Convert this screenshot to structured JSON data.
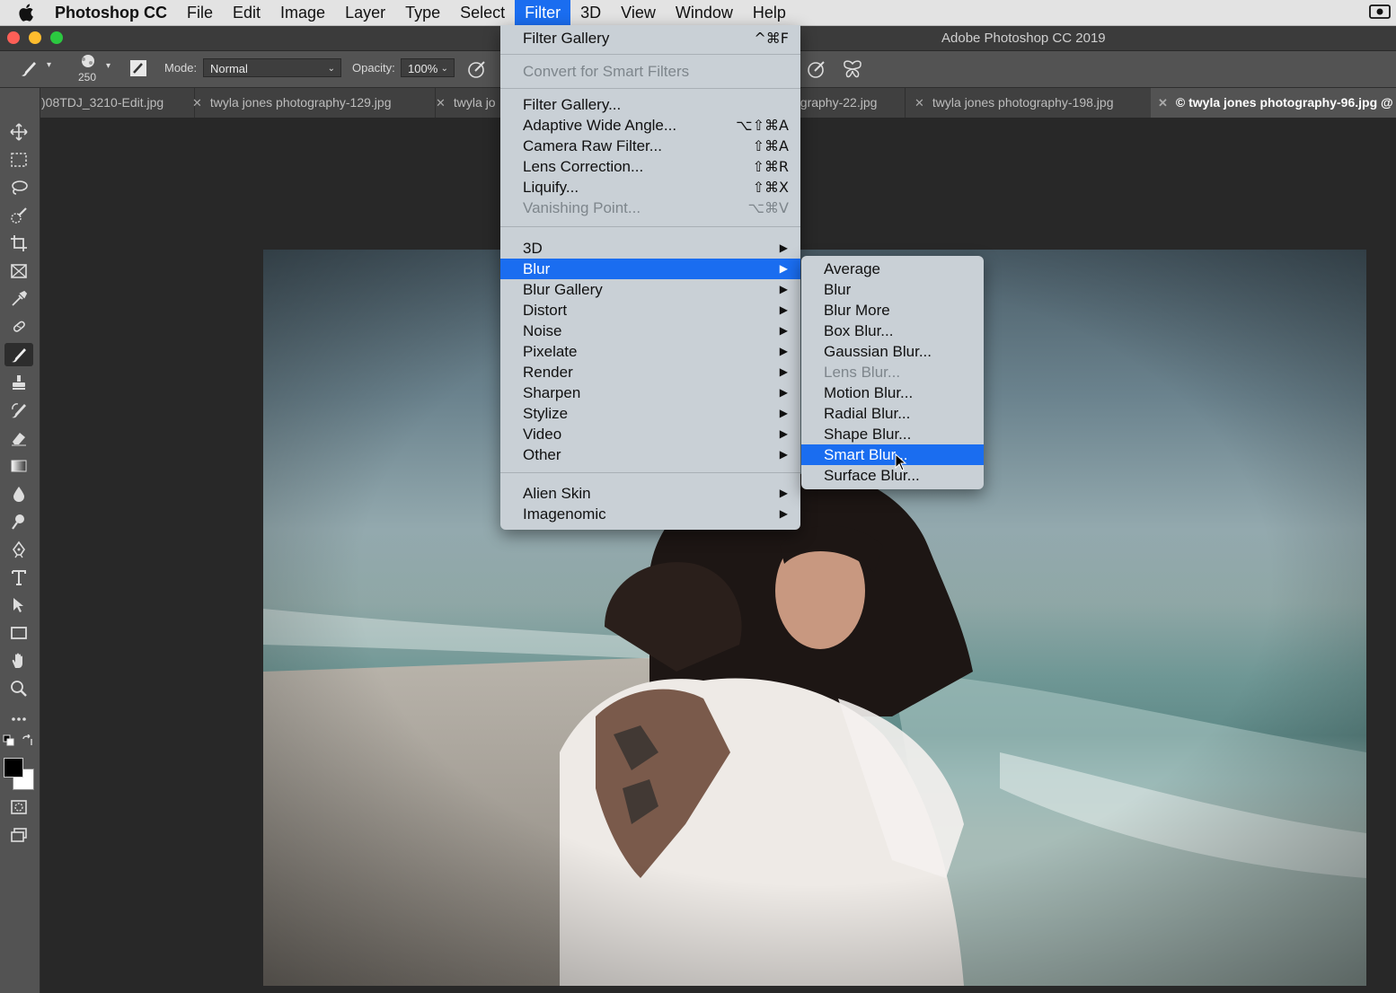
{
  "menubar": {
    "app": "Photoshop CC",
    "items": [
      "File",
      "Edit",
      "Image",
      "Layer",
      "Type",
      "Select",
      "Filter",
      "3D",
      "View",
      "Window",
      "Help"
    ],
    "active": "Filter"
  },
  "window": {
    "title": "Adobe Photoshop CC 2019"
  },
  "options": {
    "brush_size": "250",
    "mode_label": "Mode:",
    "mode_value": "Normal",
    "opacity_label": "Opacity:",
    "opacity_value": "100%"
  },
  "tabs": [
    {
      "label": ")08TDJ_3210-Edit.jpg",
      "closable": false
    },
    {
      "label": "twyla jones photography-129.jpg",
      "closable": true
    },
    {
      "label": "twyla jo",
      "closable": true
    },
    {
      "label": "ography-22.jpg",
      "closable": false
    },
    {
      "label": "twyla jones photography-198.jpg",
      "closable": true
    },
    {
      "label": "© twyla jones photography-96.jpg @",
      "closable": true,
      "active": true
    }
  ],
  "filter_menu": {
    "top_items": [
      {
        "label": "Filter Gallery",
        "shortcut": "^⌘F"
      },
      {
        "label": "Convert for Smart Filters",
        "disabled": true
      }
    ],
    "filters": [
      {
        "label": "Filter Gallery..."
      },
      {
        "label": "Adaptive Wide Angle...",
        "shortcut": "⌥⇧⌘A"
      },
      {
        "label": "Camera Raw Filter...",
        "shortcut": "⇧⌘A"
      },
      {
        "label": "Lens Correction...",
        "shortcut": "⇧⌘R"
      },
      {
        "label": "Liquify...",
        "shortcut": "⇧⌘X"
      },
      {
        "label": "Vanishing Point...",
        "shortcut": "⌥⌘V",
        "disabled": true
      }
    ],
    "submenus": [
      "3D",
      "Blur",
      "Blur Gallery",
      "Distort",
      "Noise",
      "Pixelate",
      "Render",
      "Sharpen",
      "Stylize",
      "Video",
      "Other"
    ],
    "plugins": [
      "Alien Skin",
      "Imagenomic"
    ],
    "highlighted": "Blur"
  },
  "blur_menu": {
    "items": [
      "Average",
      "Blur",
      "Blur More",
      "Box Blur...",
      "Gaussian Blur...",
      "Lens Blur...",
      "Motion Blur...",
      "Radial Blur...",
      "Shape Blur...",
      "Smart Blur...",
      "Surface Blur..."
    ],
    "disabled": [
      "Lens Blur..."
    ],
    "highlighted": "Smart Blur..."
  },
  "tools": [
    "move-tool",
    "marquee-tool",
    "lasso-tool",
    "quick-select-tool",
    "crop-tool",
    "frame-tool",
    "eyedropper-tool",
    "healing-tool",
    "brush-tool",
    "stamp-tool",
    "history-brush-tool",
    "eraser-tool",
    "gradient-tool",
    "blur-tool",
    "dodge-tool",
    "pen-tool",
    "type-tool",
    "path-select-tool",
    "rectangle-tool",
    "hand-tool",
    "zoom-tool",
    "more-tools"
  ],
  "colors": {
    "accent": "#1a6df0",
    "menu_bg": "#c9d0d6",
    "panel": "#535353",
    "canvas_bg": "#282828"
  }
}
